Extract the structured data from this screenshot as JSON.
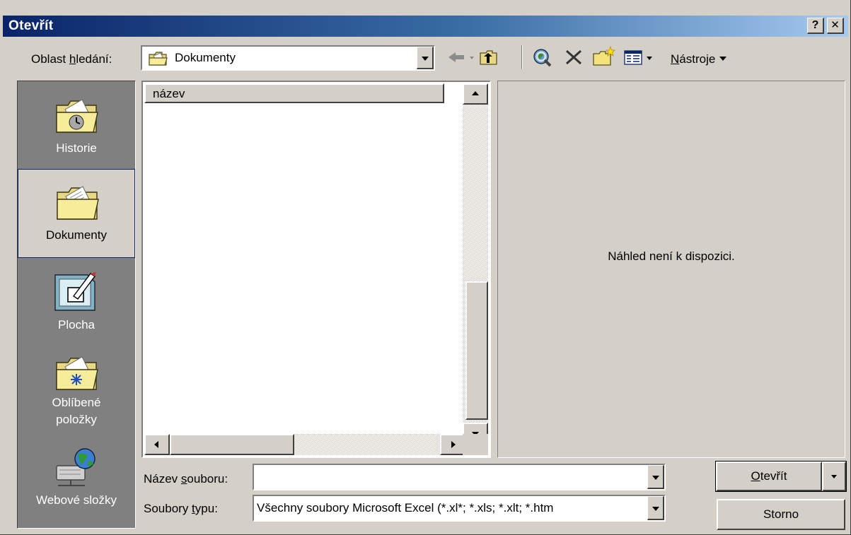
{
  "window": {
    "title": "Otevřít",
    "help_glyph": "?",
    "close_glyph": "✕"
  },
  "look_in": {
    "label_prefix": "Oblast ",
    "label_accel": "h",
    "label_suffix": "ledání:",
    "value": "Dokumenty"
  },
  "toolbar": {
    "tools_accel": "N",
    "tools_rest": "ástroje"
  },
  "places": [
    {
      "label": "Historie"
    },
    {
      "label": "Dokumenty"
    },
    {
      "label": "Plocha"
    },
    {
      "label_line1": "Oblíbené",
      "label_line2": "položky"
    },
    {
      "label": "Webové složky"
    }
  ],
  "file_list": {
    "column_name": "název"
  },
  "preview": {
    "text": "Náhled není k dispozici."
  },
  "filename": {
    "label_prefix": "Název ",
    "label_accel": "s",
    "label_suffix": "ouboru:",
    "value": ""
  },
  "filetype": {
    "label_prefix": "Soubory ",
    "label_accel": "t",
    "label_suffix": "ypu:",
    "value": "Všechny soubory Microsoft Excel (*.xl*; *.xls; *.xlt; *.htm"
  },
  "buttons": {
    "open_accel": "O",
    "open_rest": "tevřít",
    "cancel": "Storno"
  },
  "colors": {
    "title_start": "#0a246a",
    "title_end": "#a6caf0",
    "face": "#d4d0c8",
    "places_bg": "#808080"
  }
}
